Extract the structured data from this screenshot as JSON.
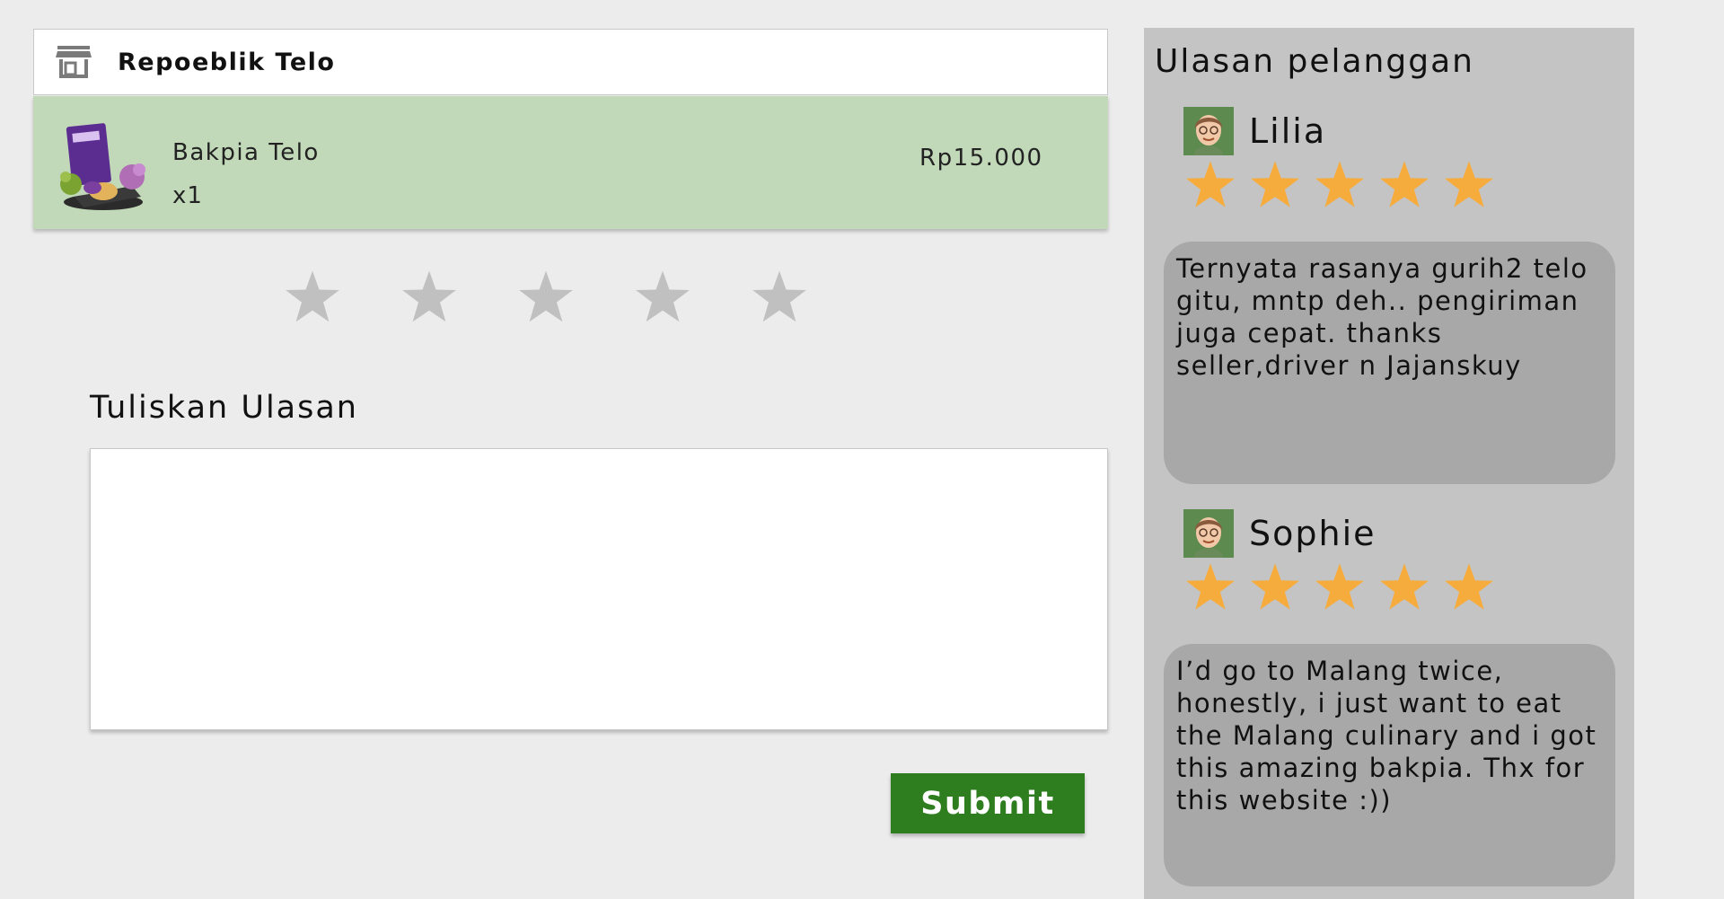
{
  "store": {
    "name": "Repoeblik Telo",
    "icon": "store-icon"
  },
  "product": {
    "name": "Bakpia Telo",
    "quantity": "x1",
    "price": "Rp15.000",
    "image": "bakpia-telo-product-image"
  },
  "rating_input": {
    "selected": 0,
    "max": 5,
    "empty_color": "#c0c0c0"
  },
  "review_form": {
    "title": "Tuliskan Ulasan",
    "textarea_value": "",
    "submit_label": "Submit"
  },
  "customer_reviews": {
    "title": "Ulasan pelanggan",
    "star_color": "#f6ac3c",
    "items": [
      {
        "name": "Lilia",
        "rating": 5,
        "text": "Ternyata rasanya gurih2 telo gitu, mntp deh.. pengiriman juga cepat. thanks seller,driver n Jajanskuy"
      },
      {
        "name": "Sophie",
        "rating": 5,
        "text": "I’d go to Malang twice, honestly, i just want to eat the Malang culinary and i got this amazing bakpia. Thx for this website :))"
      }
    ]
  },
  "colors": {
    "product_row_bg": "#c1d9b8",
    "submit_bg": "#2e7d1e",
    "panel_bg": "#c4c4c4",
    "bubble_bg": "#a8a8a8"
  }
}
